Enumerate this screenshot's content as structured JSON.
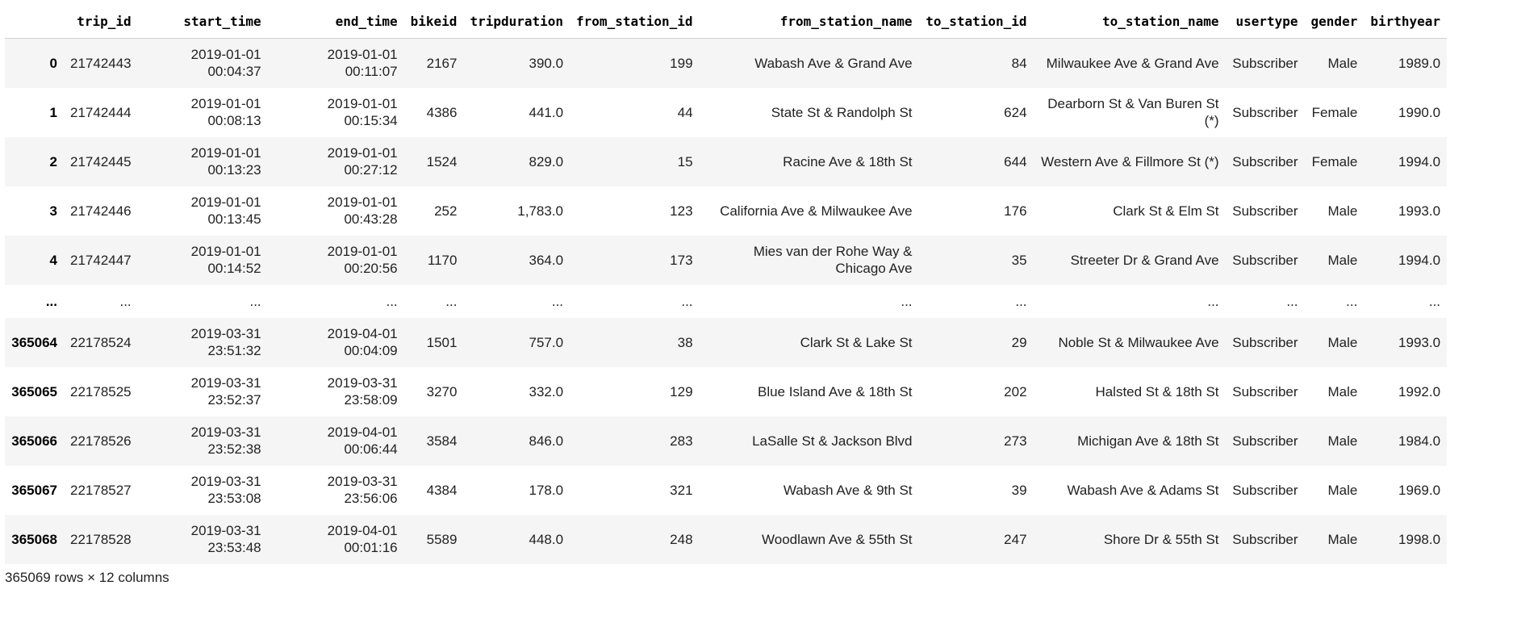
{
  "table": {
    "columns": [
      "",
      "trip_id",
      "start_time",
      "end_time",
      "bikeid",
      "tripduration",
      "from_station_id",
      "from_station_name",
      "to_station_id",
      "to_station_name",
      "usertype",
      "gender",
      "birthyear"
    ],
    "rows": [
      [
        "0",
        "21742443",
        "2019-01-01 00:04:37",
        "2019-01-01 00:11:07",
        "2167",
        "390.0",
        "199",
        "Wabash Ave & Grand Ave",
        "84",
        "Milwaukee Ave & Grand Ave",
        "Subscriber",
        "Male",
        "1989.0"
      ],
      [
        "1",
        "21742444",
        "2019-01-01 00:08:13",
        "2019-01-01 00:15:34",
        "4386",
        "441.0",
        "44",
        "State St & Randolph St",
        "624",
        "Dearborn St & Van Buren St (*)",
        "Subscriber",
        "Female",
        "1990.0"
      ],
      [
        "2",
        "21742445",
        "2019-01-01 00:13:23",
        "2019-01-01 00:27:12",
        "1524",
        "829.0",
        "15",
        "Racine Ave & 18th St",
        "644",
        "Western Ave & Fillmore St (*)",
        "Subscriber",
        "Female",
        "1994.0"
      ],
      [
        "3",
        "21742446",
        "2019-01-01 00:13:45",
        "2019-01-01 00:43:28",
        "252",
        "1,783.0",
        "123",
        "California Ave & Milwaukee Ave",
        "176",
        "Clark St & Elm St",
        "Subscriber",
        "Male",
        "1993.0"
      ],
      [
        "4",
        "21742447",
        "2019-01-01 00:14:52",
        "2019-01-01 00:20:56",
        "1170",
        "364.0",
        "173",
        "Mies van der Rohe Way & Chicago Ave",
        "35",
        "Streeter Dr & Grand Ave",
        "Subscriber",
        "Male",
        "1994.0"
      ],
      [
        "...",
        "...",
        "...",
        "...",
        "...",
        "...",
        "...",
        "...",
        "...",
        "...",
        "...",
        "...",
        "..."
      ],
      [
        "365064",
        "22178524",
        "2019-03-31 23:51:32",
        "2019-04-01 00:04:09",
        "1501",
        "757.0",
        "38",
        "Clark St & Lake St",
        "29",
        "Noble St & Milwaukee Ave",
        "Subscriber",
        "Male",
        "1993.0"
      ],
      [
        "365065",
        "22178525",
        "2019-03-31 23:52:37",
        "2019-03-31 23:58:09",
        "3270",
        "332.0",
        "129",
        "Blue Island Ave & 18th St",
        "202",
        "Halsted St & 18th St",
        "Subscriber",
        "Male",
        "1992.0"
      ],
      [
        "365066",
        "22178526",
        "2019-03-31 23:52:38",
        "2019-04-01 00:06:44",
        "3584",
        "846.0",
        "283",
        "LaSalle St & Jackson Blvd",
        "273",
        "Michigan Ave & 18th St",
        "Subscriber",
        "Male",
        "1984.0"
      ],
      [
        "365067",
        "22178527",
        "2019-03-31 23:53:08",
        "2019-03-31 23:56:06",
        "4384",
        "178.0",
        "321",
        "Wabash Ave & 9th St",
        "39",
        "Wabash Ave & Adams St",
        "Subscriber",
        "Male",
        "1969.0"
      ],
      [
        "365068",
        "22178528",
        "2019-03-31 23:53:48",
        "2019-04-01 00:01:16",
        "5589",
        "448.0",
        "248",
        "Woodlawn Ave & 55th St",
        "247",
        "Shore Dr & 55th St",
        "Subscriber",
        "Male",
        "1998.0"
      ]
    ]
  },
  "footer": {
    "shape_text": "365069 rows × 12 columns"
  }
}
